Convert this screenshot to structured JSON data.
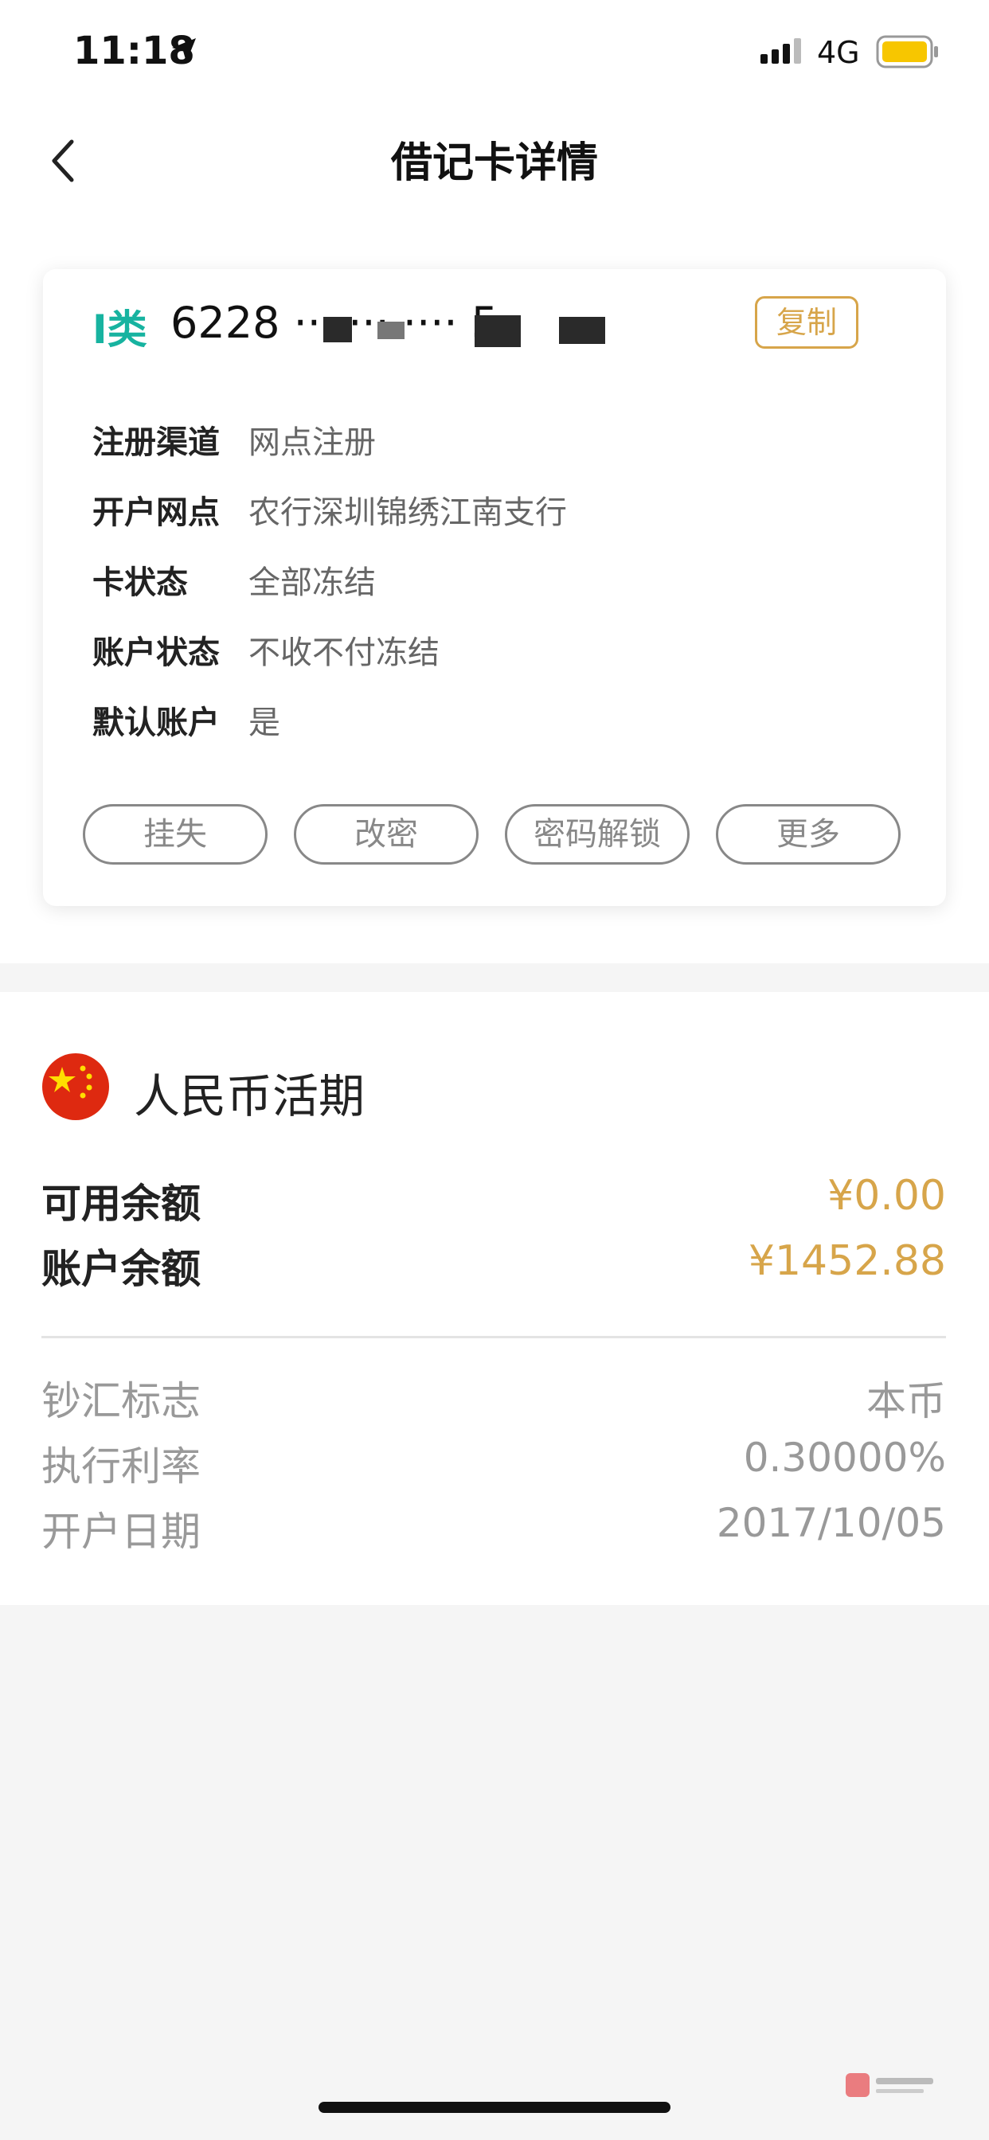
{
  "status_bar": {
    "time": "11:18",
    "network": "4G",
    "icons": [
      "location-arrow-icon",
      "signal-icon",
      "battery-icon"
    ]
  },
  "nav": {
    "title": "借记卡详情",
    "back_icon": "chevron-left-icon"
  },
  "card": {
    "type": "I类",
    "number": "6228 ··· ··· ···· 5",
    "copy_label": "复制",
    "info": [
      {
        "label": "注册渠道",
        "value": "网点注册"
      },
      {
        "label": "开户网点",
        "value": "农行深圳锦绣江南支行"
      },
      {
        "label": "卡状态",
        "value": "全部冻结"
      },
      {
        "label": "账户状态",
        "value": "不收不付冻结"
      },
      {
        "label": "默认账户",
        "value": "是"
      }
    ],
    "actions": [
      "挂失",
      "改密",
      "密码解锁",
      "更多"
    ]
  },
  "account": {
    "title": "人民币活期",
    "flag_icon": "china-flag-icon",
    "available_label": "可用余额",
    "available_value": "¥0.00",
    "balance_label": "账户余额",
    "balance_value": "¥1452.88",
    "details": [
      {
        "label": "钞汇标志",
        "value": "本币"
      },
      {
        "label": "执行利率",
        "value": "0.30000%"
      },
      {
        "label": "开户日期",
        "value": "2017/10/05"
      }
    ]
  },
  "colors": {
    "accent_gold": "#d7a54a",
    "card_type_green": "#17b3a0",
    "background": "#f5f5f5"
  }
}
